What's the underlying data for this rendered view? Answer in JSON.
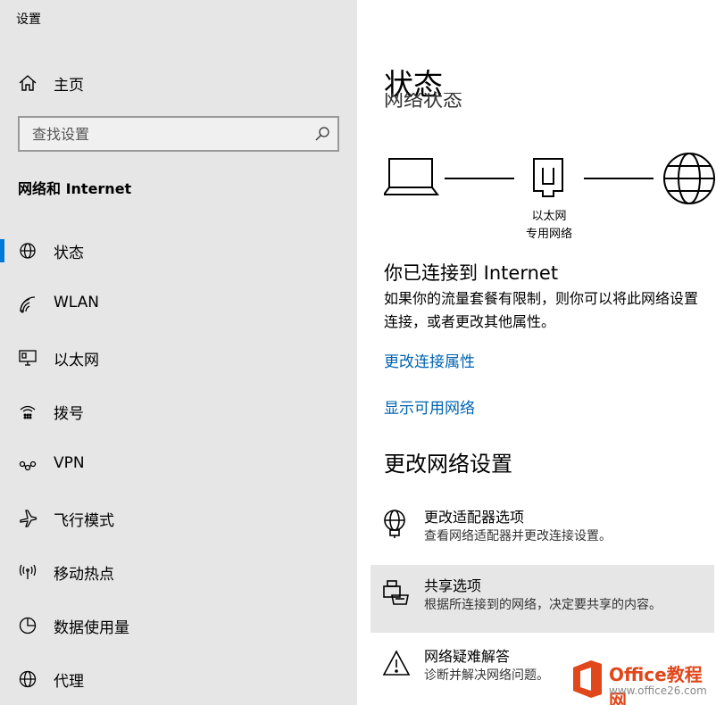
{
  "app": {
    "title": "设置"
  },
  "sidebar": {
    "home_label": "主页",
    "search_placeholder": "查找设置",
    "section_title": "网络和 Internet",
    "items": [
      {
        "label": "状态",
        "icon": "globe-status-icon",
        "selected": true
      },
      {
        "label": "WLAN",
        "icon": "wifi-icon",
        "selected": false
      },
      {
        "label": "以太网",
        "icon": "ethernet-monitor-icon",
        "selected": false
      },
      {
        "label": "拨号",
        "icon": "dialup-icon",
        "selected": false
      },
      {
        "label": "VPN",
        "icon": "vpn-icon",
        "selected": false
      },
      {
        "label": "飞行模式",
        "icon": "airplane-icon",
        "selected": false
      },
      {
        "label": "移动热点",
        "icon": "hotspot-icon",
        "selected": false
      },
      {
        "label": "数据使用量",
        "icon": "pie-chart-icon",
        "selected": false
      },
      {
        "label": "代理",
        "icon": "globe-icon",
        "selected": false
      }
    ]
  },
  "main": {
    "page_title": "状态",
    "partial_subheading": "网络状态",
    "diagram": {
      "network_name": "以太网",
      "network_type": "专用网络"
    },
    "connected_title": "你已连接到 Internet",
    "connected_desc_line1": "如果你的流量套餐有限制，则你可以将此网络设置",
    "connected_desc_line2": "连接，或者更改其他属性。",
    "link_change_properties": "更改连接属性",
    "link_show_networks": "显示可用网络",
    "settings_title": "更改网络设置",
    "options": [
      {
        "title": "更改适配器选项",
        "desc": "查看网络适配器并更改连接设置。",
        "icon": "adapter-globe-icon"
      },
      {
        "title": "共享选项",
        "desc": "根据所连接到的网络，决定要共享的内容。",
        "icon": "sharing-icon"
      },
      {
        "title": "网络疑难解答",
        "desc": "诊断并解决网络问题。",
        "icon": "warning-icon"
      }
    ]
  },
  "watermark": {
    "line1": "Office教程网",
    "line2": "www.office26.com"
  },
  "colors": {
    "sidebar_bg": "#e6e6e6",
    "accent": "#0078d7",
    "link": "#0063b1",
    "hover_bg": "#e6e6e6",
    "watermark": "#e0471b"
  }
}
